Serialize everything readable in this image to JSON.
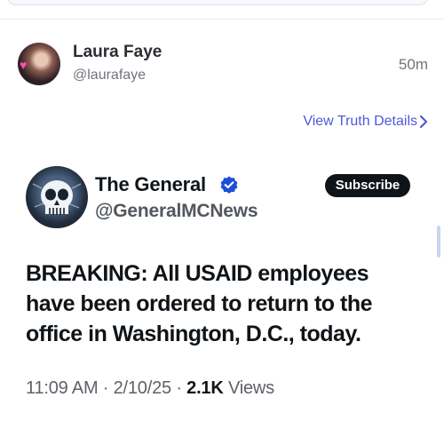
{
  "post": {
    "author_name": "Laura Faye",
    "author_handle": "@laurafaye",
    "time_ago": "50m",
    "details_link": "View Truth Details"
  },
  "quoted_post": {
    "author_name": "The General",
    "author_handle": "@GeneralMCNews",
    "subscribe_label": "Subscribe",
    "text": "BREAKING: All USAID employees have been ordered to return to the office in Washington, D.C., today.",
    "meta": {
      "time": "11:09 AM",
      "date": "2/10/25",
      "views_count": "2.1K",
      "views_label": "Views",
      "separator": "·"
    }
  },
  "icons": {
    "details_chevron": "chevron-right-icon",
    "verified_badge": "verified-icon",
    "quoted_avatar_art": "skull-icon"
  },
  "colors": {
    "link": "#4e5ad8",
    "verified": "#1d9bf0",
    "subscribe_bg": "#0f1419",
    "muted_text": "#6f747c"
  }
}
